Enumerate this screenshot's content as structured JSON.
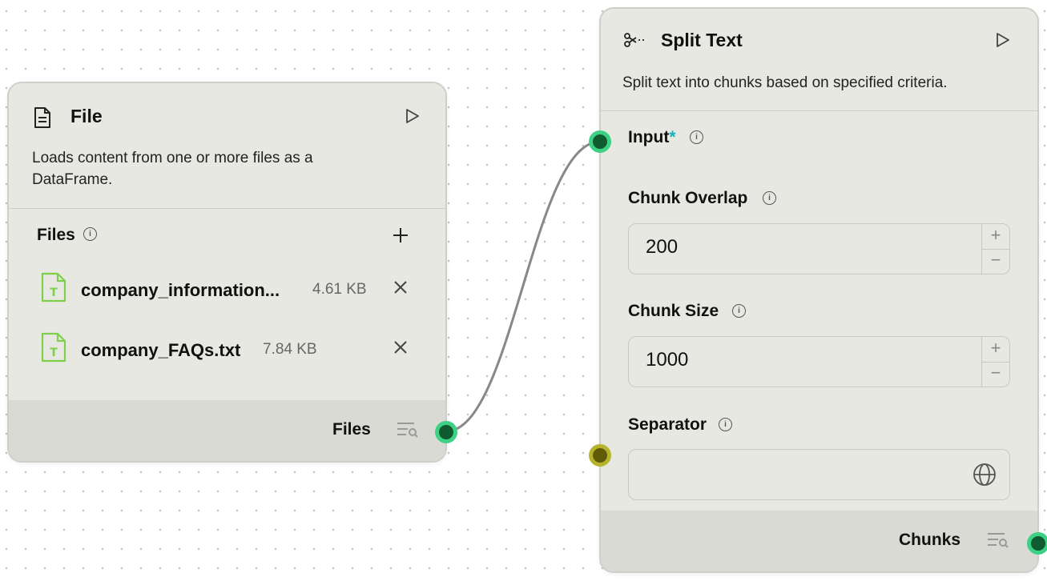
{
  "file_node": {
    "title": "File",
    "description": "Loads content from one or more files as a DataFrame.",
    "files_label": "Files",
    "files": [
      {
        "name": "company_information...",
        "size": "4.61 KB"
      },
      {
        "name": "company_FAQs.txt",
        "size": "7.84 KB"
      }
    ],
    "output_label": "Files"
  },
  "split_node": {
    "title": "Split Text",
    "description": "Split text into chunks based on specified criteria.",
    "input_label": "Input",
    "required_marker": "*",
    "chunk_overlap_label": "Chunk Overlap",
    "chunk_overlap_value": "200",
    "chunk_size_label": "Chunk Size",
    "chunk_size_value": "1000",
    "separator_label": "Separator",
    "separator_value": "",
    "output_label": "Chunks"
  },
  "colors": {
    "handle_fill": "#0f5a2e",
    "handle_ring": "#3cd184",
    "separator_handle_ring": "#b8b32c",
    "required_marker": "#1ab0b8",
    "file_icon": "#7ed04a",
    "edge": "#888888"
  },
  "icons": {
    "file_header": "document-icon",
    "split_header": "scissors-icon",
    "run": "play-icon",
    "add": "plus-icon",
    "remove": "close-icon",
    "txt_file": "text-file-icon",
    "inspect": "list-search-icon",
    "globe": "globe-icon",
    "info": "info-icon"
  }
}
